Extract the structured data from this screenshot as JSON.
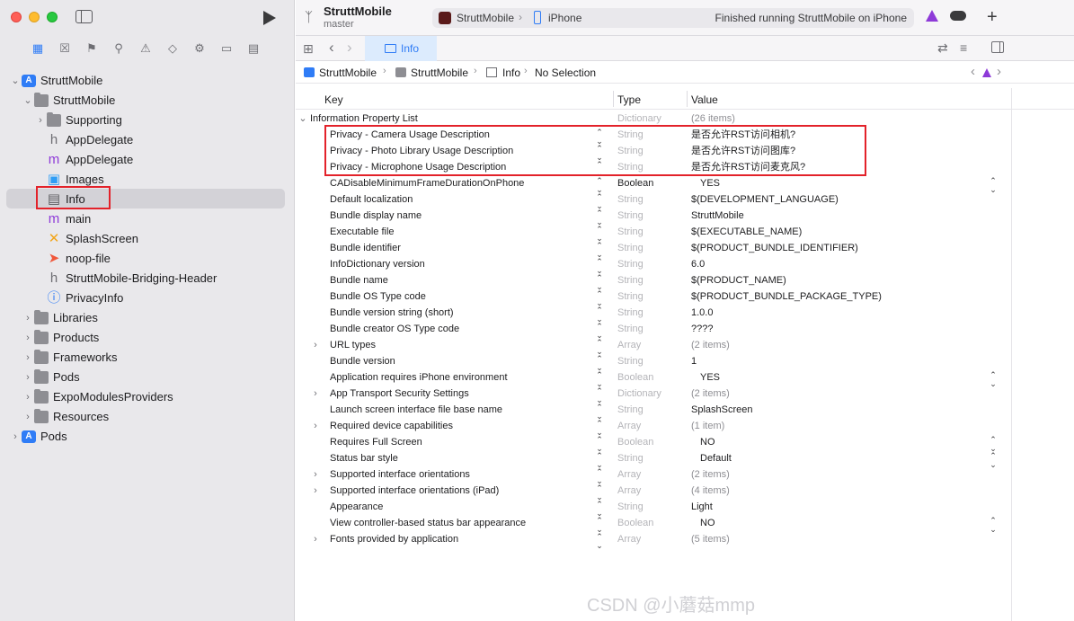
{
  "sidebar": {
    "tree": [
      {
        "label": "StruttMobile",
        "icon": "project-icon",
        "level": 0,
        "disclosure": "open"
      },
      {
        "label": "StruttMobile",
        "icon": "folder-icon",
        "level": 1,
        "disclosure": "open"
      },
      {
        "label": "Supporting",
        "icon": "folder-icon",
        "level": 2,
        "disclosure": "closed"
      },
      {
        "label": "AppDelegate",
        "icon": "header-file-icon",
        "level": 2,
        "disclosure": "none"
      },
      {
        "label": "AppDelegate",
        "icon": "objc-file-icon",
        "level": 2,
        "disclosure": "none"
      },
      {
        "label": "Images",
        "icon": "asset-catalog-icon",
        "level": 2,
        "disclosure": "none"
      },
      {
        "label": "Info",
        "icon": "plist-file-icon",
        "level": 2,
        "disclosure": "none",
        "selected": true
      },
      {
        "label": "main",
        "icon": "objc-file-icon",
        "level": 2,
        "disclosure": "none"
      },
      {
        "label": "SplashScreen",
        "icon": "storyboard-icon",
        "level": 2,
        "disclosure": "none"
      },
      {
        "label": "noop-file",
        "icon": "swift-file-icon",
        "level": 2,
        "disclosure": "none"
      },
      {
        "label": "StruttMobile-Bridging-Header",
        "icon": "header-file-icon",
        "level": 2,
        "disclosure": "none"
      },
      {
        "label": "PrivacyInfo",
        "icon": "privacy-file-icon",
        "level": 2,
        "disclosure": "none"
      },
      {
        "label": "Libraries",
        "icon": "folder-icon",
        "level": 1,
        "disclosure": "closed"
      },
      {
        "label": "Products",
        "icon": "folder-icon",
        "level": 1,
        "disclosure": "closed"
      },
      {
        "label": "Frameworks",
        "icon": "folder-icon",
        "level": 1,
        "disclosure": "closed"
      },
      {
        "label": "Pods",
        "icon": "folder-icon",
        "level": 1,
        "disclosure": "closed"
      },
      {
        "label": "ExpoModulesProviders",
        "icon": "folder-icon",
        "level": 1,
        "disclosure": "closed"
      },
      {
        "label": "Resources",
        "icon": "folder-icon",
        "level": 1,
        "disclosure": "closed"
      },
      {
        "label": "Pods",
        "icon": "project-icon",
        "level": 0,
        "disclosure": "closed"
      }
    ]
  },
  "toolbar": {
    "project_name": "StruttMobile",
    "branch": "master",
    "scheme_app": "StruttMobile",
    "scheme_device": "iPhone",
    "status": "Finished running StruttMobile on iPhone"
  },
  "tab": {
    "label": "Info"
  },
  "jumpbar": [
    "StruttMobile",
    "StruttMobile",
    "Info",
    "No Selection"
  ],
  "table": {
    "headers": {
      "key": "Key",
      "type": "Type",
      "value": "Value"
    },
    "root": {
      "key": "Information Property List",
      "type": "Dictionary",
      "value": "(26 items)"
    },
    "rows": [
      {
        "key": "Privacy - Camera Usage Description",
        "type": "String",
        "value": "是否允许RST访问相机?",
        "disclosure": false,
        "popup": false
      },
      {
        "key": "Privacy - Photo Library Usage Description",
        "type": "String",
        "value": "是否允许RST访问图库?",
        "disclosure": false,
        "popup": false
      },
      {
        "key": "Privacy - Microphone Usage Description",
        "type": "String",
        "value": "是否允许RST访问麦克风?",
        "disclosure": false,
        "popup": false
      },
      {
        "key": "CADisableMinimumFrameDurationOnPhone",
        "type": "Boolean",
        "value": "YES",
        "disclosure": false,
        "popup": true,
        "type_dark": true
      },
      {
        "key": "Default localization",
        "type": "String",
        "value": "$(DEVELOPMENT_LANGUAGE)",
        "disclosure": false,
        "popup": false
      },
      {
        "key": "Bundle display name",
        "type": "String",
        "value": "StruttMobile",
        "disclosure": false,
        "popup": false
      },
      {
        "key": "Executable file",
        "type": "String",
        "value": "$(EXECUTABLE_NAME)",
        "disclosure": false,
        "popup": false
      },
      {
        "key": "Bundle identifier",
        "type": "String",
        "value": "$(PRODUCT_BUNDLE_IDENTIFIER)",
        "disclosure": false,
        "popup": false
      },
      {
        "key": "InfoDictionary version",
        "type": "String",
        "value": "6.0",
        "disclosure": false,
        "popup": false
      },
      {
        "key": "Bundle name",
        "type": "String",
        "value": "$(PRODUCT_NAME)",
        "disclosure": false,
        "popup": false
      },
      {
        "key": "Bundle OS Type code",
        "type": "String",
        "value": "$(PRODUCT_BUNDLE_PACKAGE_TYPE)",
        "disclosure": false,
        "popup": false
      },
      {
        "key": "Bundle version string (short)",
        "type": "String",
        "value": "1.0.0",
        "disclosure": false,
        "popup": false
      },
      {
        "key": "Bundle creator OS Type code",
        "type": "String",
        "value": "????",
        "disclosure": false,
        "popup": false
      },
      {
        "key": "URL types",
        "type": "Array",
        "value": "(2 items)",
        "disclosure": true,
        "popup": false
      },
      {
        "key": "Bundle version",
        "type": "String",
        "value": "1",
        "disclosure": false,
        "popup": false
      },
      {
        "key": "Application requires iPhone environment",
        "type": "Boolean",
        "value": "YES",
        "disclosure": false,
        "popup": true
      },
      {
        "key": "App Transport Security Settings",
        "type": "Dictionary",
        "value": "(2 items)",
        "disclosure": true,
        "popup": false
      },
      {
        "key": "Launch screen interface file base name",
        "type": "String",
        "value": "SplashScreen",
        "disclosure": false,
        "popup": false
      },
      {
        "key": "Required device capabilities",
        "type": "Array",
        "value": "(1 item)",
        "disclosure": true,
        "popup": false
      },
      {
        "key": "Requires Full Screen",
        "type": "Boolean",
        "value": "NO",
        "disclosure": false,
        "popup": true
      },
      {
        "key": "Status bar style",
        "type": "String",
        "value": "Default",
        "disclosure": false,
        "popup": true
      },
      {
        "key": "Supported interface orientations",
        "type": "Array",
        "value": "(2 items)",
        "disclosure": true,
        "popup": false
      },
      {
        "key": "Supported interface orientations (iPad)",
        "type": "Array",
        "value": "(4 items)",
        "disclosure": true,
        "popup": false
      },
      {
        "key": "Appearance",
        "type": "String",
        "value": "Light",
        "disclosure": false,
        "popup": false
      },
      {
        "key": "View controller-based status bar appearance",
        "type": "Boolean",
        "value": "NO",
        "disclosure": false,
        "popup": true
      },
      {
        "key": "Fonts provided by application",
        "type": "Array",
        "value": "(5 items)",
        "disclosure": true,
        "popup": false
      }
    ]
  },
  "watermark": "CSDN @小蘑菇mmp",
  "colors": {
    "accent": "#2f7cf6",
    "highlight_box": "#e3222a",
    "warning": "#8e3ad8"
  }
}
